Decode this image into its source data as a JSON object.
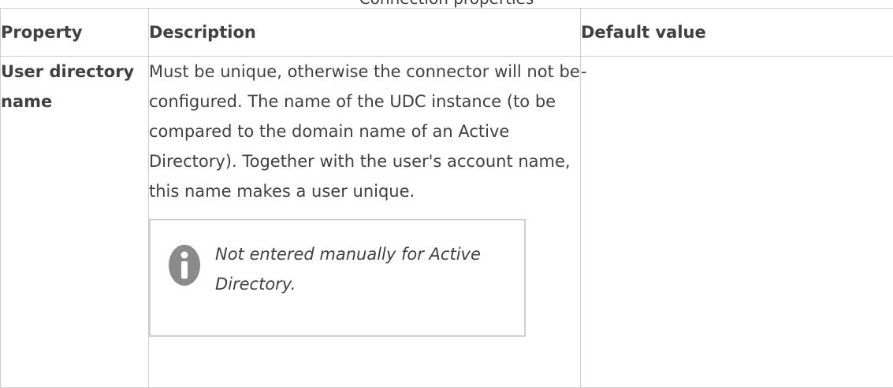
{
  "caption": "Connection properties",
  "table": {
    "headers": [
      "Property",
      "Description",
      "Default value"
    ],
    "rows": [
      {
        "property": "User directory name",
        "description": "Must be unique, otherwise the connector will not be configured. The name of the UDC instance (to be compared to the domain name of an Active Directory). Together with the user's account name, this name makes a user unique.",
        "note": {
          "icon": "info-icon",
          "text": "Not entered manually for Active Directory."
        },
        "default_value": "-"
      }
    ]
  }
}
